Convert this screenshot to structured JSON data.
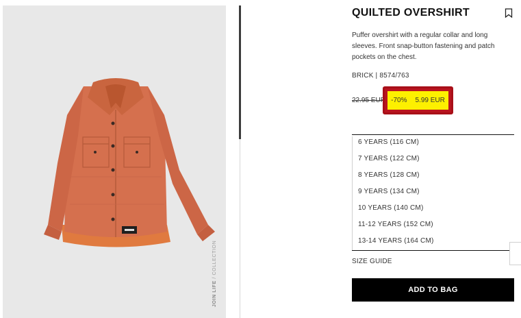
{
  "product": {
    "title": "QUILTED OVERSHIRT",
    "description": "Puffer overshirt with a regular collar and long sleeves. Front snap-button fastening and patch pockets on the chest.",
    "reference": "BRICK | 8574/763",
    "old_price": "22.95 EUR",
    "discount": "-70%",
    "new_price": "5.99 EUR",
    "image_caption_bold": "JOIN LIFE",
    "image_caption": " / COLLECTION"
  },
  "sizes": [
    "6 YEARS (116 CM)",
    "7 YEARS (122 CM)",
    "8 YEARS (128 CM)",
    "9 YEARS (134 CM)",
    "10 YEARS (140 CM)",
    "11-12 YEARS (152 CM)",
    "13-14 YEARS (164 CM)"
  ],
  "actions": {
    "size_guide": "SIZE GUIDE",
    "add_to_bag": "ADD TO BAG"
  },
  "icons": {
    "bookmark": "bookmark-icon"
  },
  "colors": {
    "highlight": "#fdf000",
    "highlight_border": "#b9141f",
    "jacket": "#d5704e",
    "button": "#000000"
  }
}
